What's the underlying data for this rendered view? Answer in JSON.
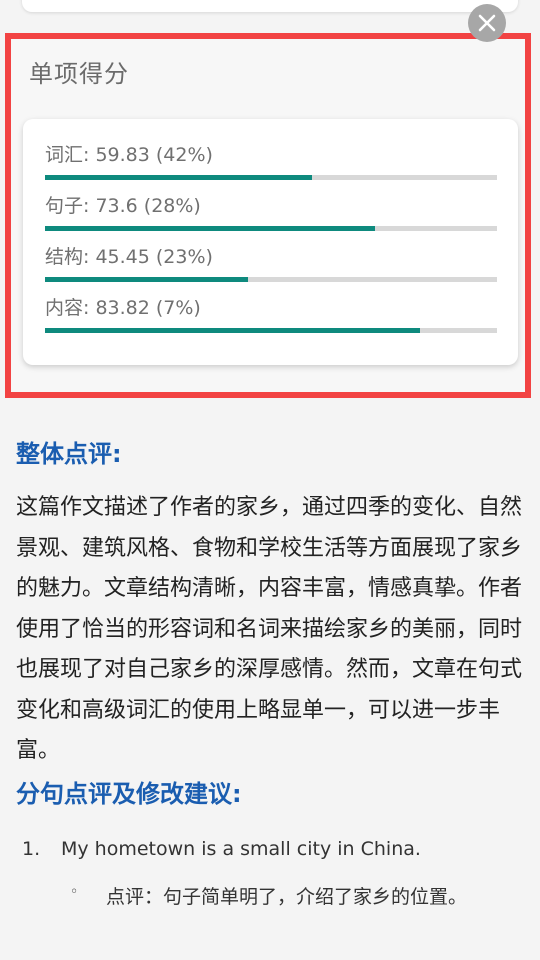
{
  "close_button": {
    "icon": "close-icon"
  },
  "scores": {
    "title": "单项得分",
    "items": [
      {
        "label": "词汇: 59.83 (42%)",
        "fill": 0.59
      },
      {
        "label": "句子: 73.6 (28%)",
        "fill": 0.73
      },
      {
        "label": "结构: 45.45 (23%)",
        "fill": 0.45
      },
      {
        "label": "内容: 83.82 (7%)",
        "fill": 0.83
      }
    ],
    "bar_color": "#0e8a7e",
    "track_color": "#d8d8d8",
    "highlight_color": "#f24343"
  },
  "overall": {
    "heading": "整体点评:",
    "text": "这篇作文描述了作者的家乡，通过四季的变化、自然景观、建筑风格、食物和学校生活等方面展现了家乡的魅力。文章结构清晰，内容丰富，情感真挚。作者使用了恰当的形容词和名词来描绘家乡的美丽，同时也展现了对自己家乡的深厚感情。然而，文章在句式变化和高级词汇的使用上略显单一，可以进一步丰富。"
  },
  "sentences": {
    "heading": "分句点评及修改建议:",
    "items": [
      {
        "number": "1.",
        "sentence": "My hometown is a small city in China.",
        "bullet": "◦",
        "comment": "点评：句子简单明了，介绍了家乡的位置。"
      }
    ]
  }
}
